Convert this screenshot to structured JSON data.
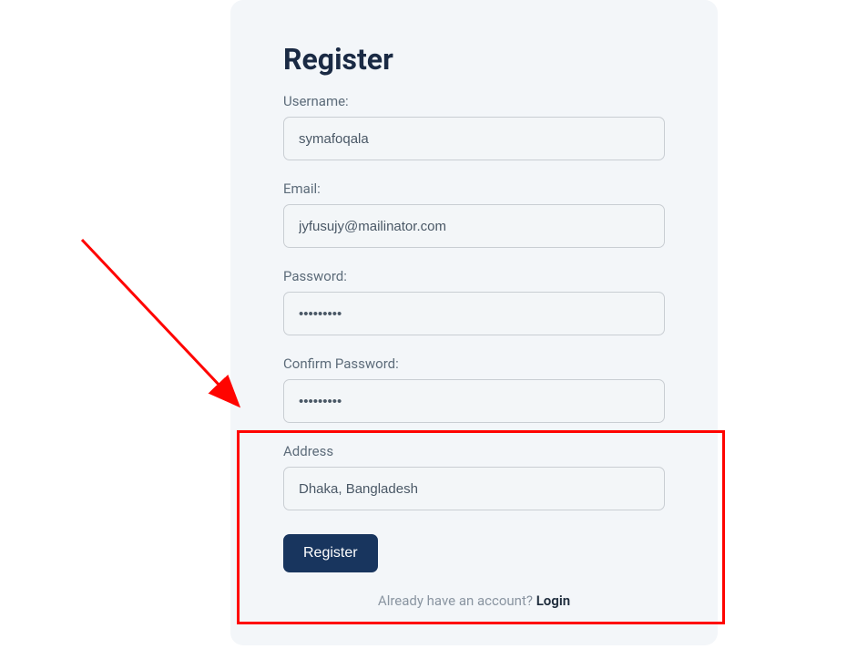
{
  "form": {
    "title": "Register",
    "fields": {
      "username": {
        "label": "Username:",
        "value": "symafoqala"
      },
      "email": {
        "label": "Email:",
        "value": "jyfusujy@mailinator.com"
      },
      "password": {
        "label": "Password:",
        "value": "•••••••••"
      },
      "confirm_password": {
        "label": "Confirm Password:",
        "value": "•••••••••"
      },
      "address": {
        "label": "Address",
        "value": "Dhaka, Bangladesh"
      }
    },
    "submit_label": "Register",
    "footer_text": "Already have an account? ",
    "login_link": "Login"
  }
}
